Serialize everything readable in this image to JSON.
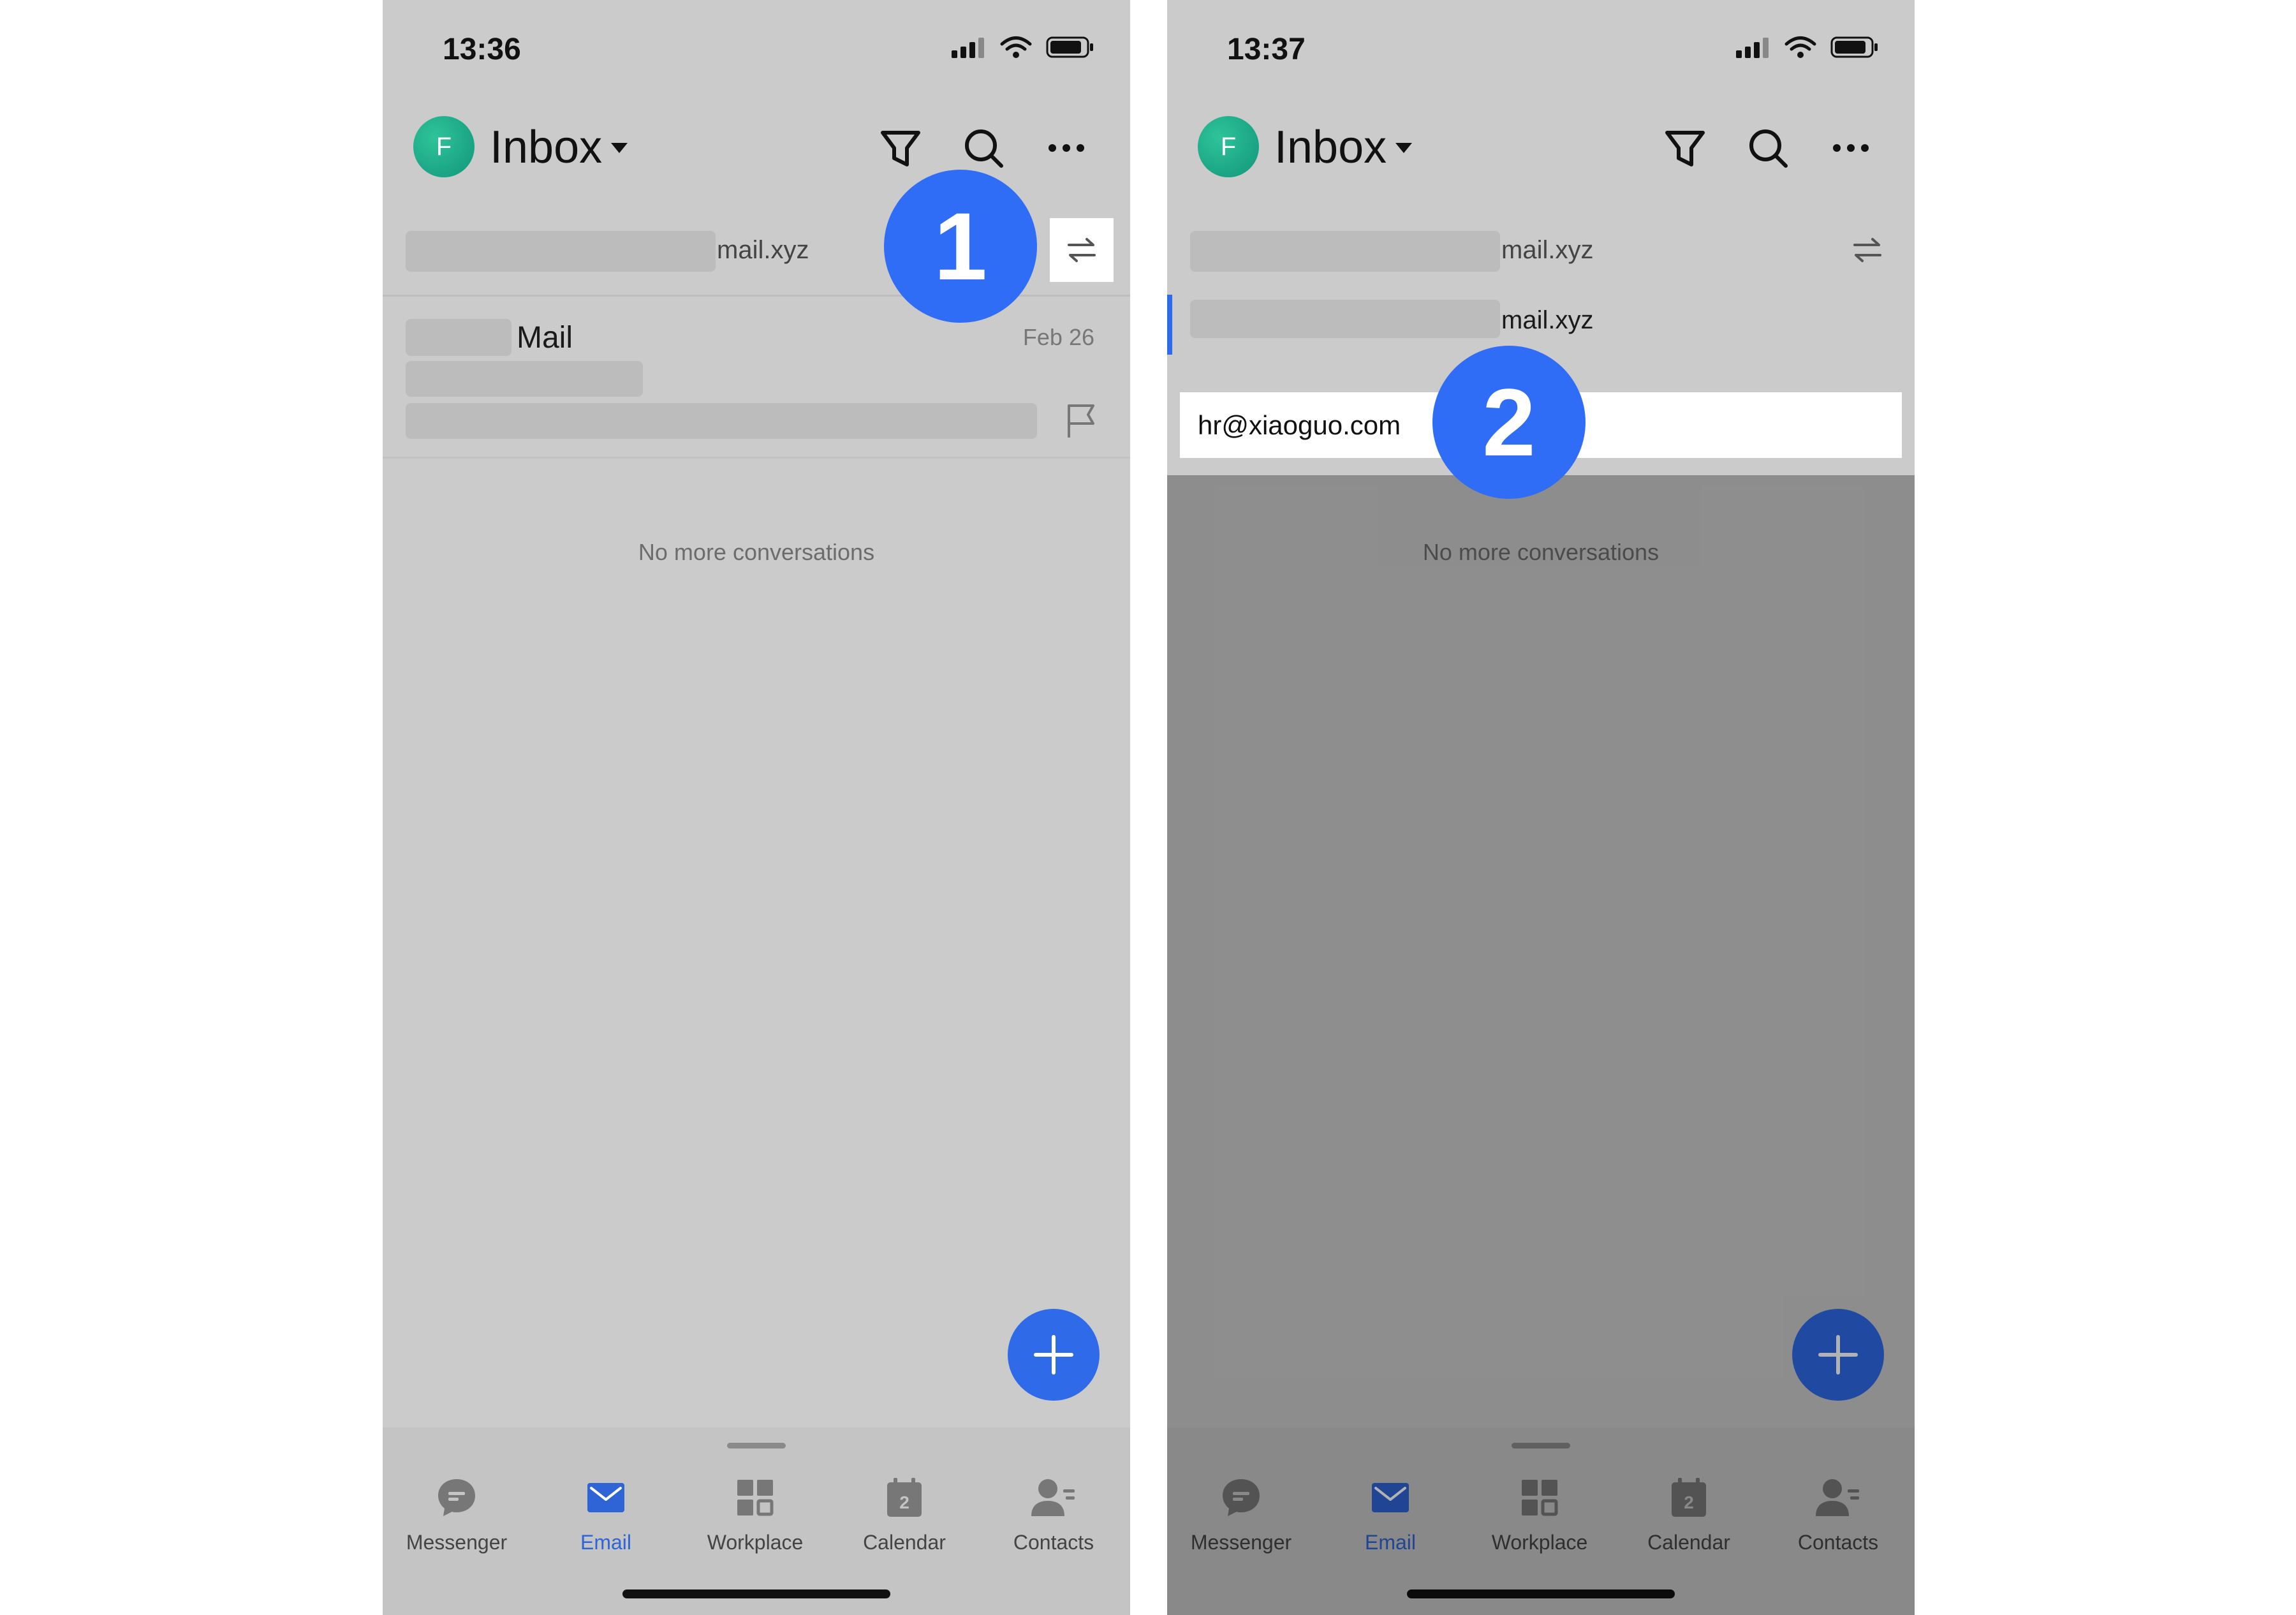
{
  "colors": {
    "accent": "#2f6ae8",
    "badge": "#2f6df6",
    "avatar": "#11957a",
    "screen_bg": "#cbcbcb"
  },
  "screens": [
    {
      "status_time": "13:36",
      "avatar_letter": "F",
      "mailbox_title": "Inbox",
      "account_suffix": "mail.xyz",
      "mail_item": {
        "subject": "Mail",
        "date": "Feb 26"
      },
      "no_more": "No more conversations",
      "step_badge": "1",
      "tabs": [
        {
          "label": "Messenger",
          "icon": "messenger-icon"
        },
        {
          "label": "Email",
          "icon": "email-icon",
          "active": true
        },
        {
          "label": "Workplace",
          "icon": "workplace-icon"
        },
        {
          "label": "Calendar",
          "icon": "calendar-icon",
          "day": "2"
        },
        {
          "label": "Contacts",
          "icon": "contacts-icon"
        }
      ]
    },
    {
      "status_time": "13:37",
      "avatar_letter": "F",
      "mailbox_title": "Inbox",
      "account_suffix_1": "mail.xyz",
      "account_suffix_2": "mail.xyz",
      "account_option": "hr@xiaoguo.com",
      "no_more": "No more conversations",
      "step_badge": "2",
      "tabs": [
        {
          "label": "Messenger",
          "icon": "messenger-icon"
        },
        {
          "label": "Email",
          "icon": "email-icon",
          "active": true
        },
        {
          "label": "Workplace",
          "icon": "workplace-icon"
        },
        {
          "label": "Calendar",
          "icon": "calendar-icon",
          "day": "2"
        },
        {
          "label": "Contacts",
          "icon": "contacts-icon"
        }
      ]
    }
  ]
}
